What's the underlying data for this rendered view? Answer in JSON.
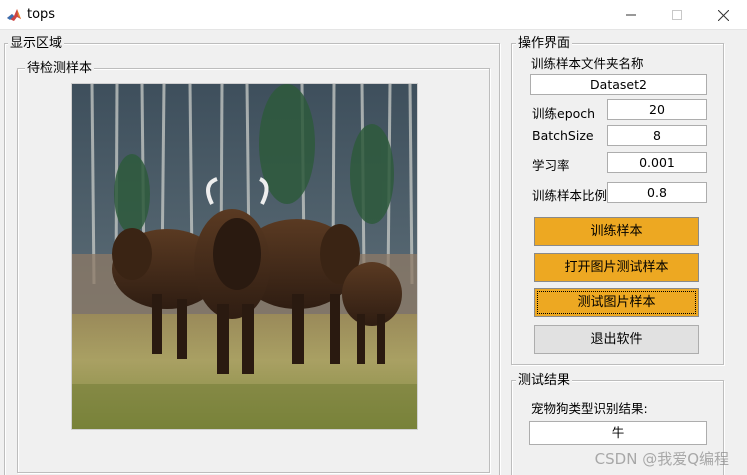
{
  "window": {
    "title": "tops"
  },
  "display_area": {
    "title": "显示区域",
    "sample_panel": {
      "title": "待检测样本",
      "image": "bison-herd-photo"
    }
  },
  "operations": {
    "title": "操作界面",
    "folder_label": "训练样本文件夹名称",
    "folder_value": "Dataset2",
    "epoch_label": "训练epoch",
    "epoch_value": "20",
    "batch_label": "BatchSize",
    "batch_value": "8",
    "lr_label": "学习率",
    "lr_value": "0.001",
    "ratio_label": "训练样本比例",
    "ratio_value": "0.8",
    "buttons": {
      "train": "训练样本",
      "open_image": "打开图片测试样本",
      "test_image": "测试图片样本",
      "exit": "退出软件"
    }
  },
  "result": {
    "title": "测试结果",
    "label": "宠物狗类型识别结果:",
    "value": "牛"
  },
  "watermark": "CSDN @我爱Q编程",
  "colors": {
    "accent_button": "#eda822",
    "neutral_button": "#e1e1e1",
    "window_bg": "#f0f0f0"
  }
}
